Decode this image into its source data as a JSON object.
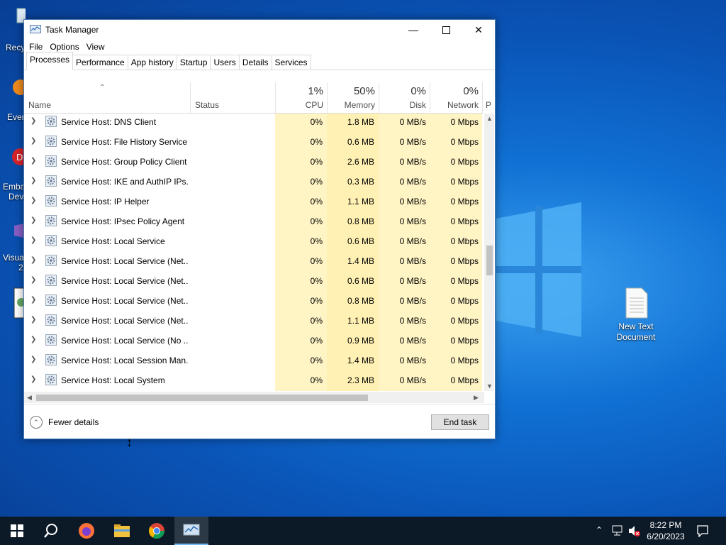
{
  "desktop": {
    "left_labels": [
      "Recy",
      "Ever",
      "Emba",
      "Devi",
      "Visua",
      "2"
    ],
    "new_text_doc": "New Text\nDocument"
  },
  "window": {
    "title": "Task Manager",
    "menu": [
      "File",
      "Options",
      "View"
    ],
    "tabs": [
      "Processes",
      "Performance",
      "App history",
      "Startup",
      "Users",
      "Details",
      "Services"
    ],
    "active_tab": "Processes",
    "columns": {
      "name": "Name",
      "status": "Status",
      "cpu": {
        "pct": "1%",
        "label": "CPU"
      },
      "memory": {
        "pct": "50%",
        "label": "Memory"
      },
      "disk": {
        "pct": "0%",
        "label": "Disk"
      },
      "network": {
        "pct": "0%",
        "label": "Network"
      },
      "power": "P"
    },
    "processes": [
      {
        "name": "Service Host: DNS Client",
        "cpu": "0%",
        "memory": "1.8 MB",
        "disk": "0 MB/s",
        "network": "0 Mbps"
      },
      {
        "name": "Service Host: File History Service",
        "cpu": "0%",
        "memory": "0.6 MB",
        "disk": "0 MB/s",
        "network": "0 Mbps"
      },
      {
        "name": "Service Host: Group Policy Client",
        "cpu": "0%",
        "memory": "2.6 MB",
        "disk": "0 MB/s",
        "network": "0 Mbps"
      },
      {
        "name": "Service Host: IKE and AuthIP IPs...",
        "cpu": "0%",
        "memory": "0.3 MB",
        "disk": "0 MB/s",
        "network": "0 Mbps"
      },
      {
        "name": "Service Host: IP Helper",
        "cpu": "0%",
        "memory": "1.1 MB",
        "disk": "0 MB/s",
        "network": "0 Mbps"
      },
      {
        "name": "Service Host: IPsec Policy Agent",
        "cpu": "0%",
        "memory": "0.8 MB",
        "disk": "0 MB/s",
        "network": "0 Mbps"
      },
      {
        "name": "Service Host: Local Service",
        "cpu": "0%",
        "memory": "0.6 MB",
        "disk": "0 MB/s",
        "network": "0 Mbps"
      },
      {
        "name": "Service Host: Local Service (Net...",
        "cpu": "0%",
        "memory": "1.4 MB",
        "disk": "0 MB/s",
        "network": "0 Mbps"
      },
      {
        "name": "Service Host: Local Service (Net...",
        "cpu": "0%",
        "memory": "0.6 MB",
        "disk": "0 MB/s",
        "network": "0 Mbps"
      },
      {
        "name": "Service Host: Local Service (Net...",
        "cpu": "0%",
        "memory": "0.8 MB",
        "disk": "0 MB/s",
        "network": "0 Mbps"
      },
      {
        "name": "Service Host: Local Service (Net...",
        "cpu": "0%",
        "memory": "1.1 MB",
        "disk": "0 MB/s",
        "network": "0 Mbps"
      },
      {
        "name": "Service Host: Local Service (No ...",
        "cpu": "0%",
        "memory": "0.9 MB",
        "disk": "0 MB/s",
        "network": "0 Mbps"
      },
      {
        "name": "Service Host: Local Session Man...",
        "cpu": "0%",
        "memory": "1.4 MB",
        "disk": "0 MB/s",
        "network": "0 Mbps"
      },
      {
        "name": "Service Host: Local System",
        "cpu": "0%",
        "memory": "2.3 MB",
        "disk": "0 MB/s",
        "network": "0 Mbps"
      }
    ],
    "fewer_details": "Fewer details",
    "end_task": "End task"
  },
  "taskbar": {
    "icons": [
      "start-icon",
      "search-icon",
      "firefox-icon",
      "file-explorer-icon",
      "chrome-icon",
      "task-manager-icon"
    ],
    "clock_time": "8:22 PM",
    "clock_date": "6/20/2023"
  },
  "colors": {
    "heat": "#fff4c4",
    "taskbar": "#0c1a28",
    "desktop": "#0a55b8"
  }
}
